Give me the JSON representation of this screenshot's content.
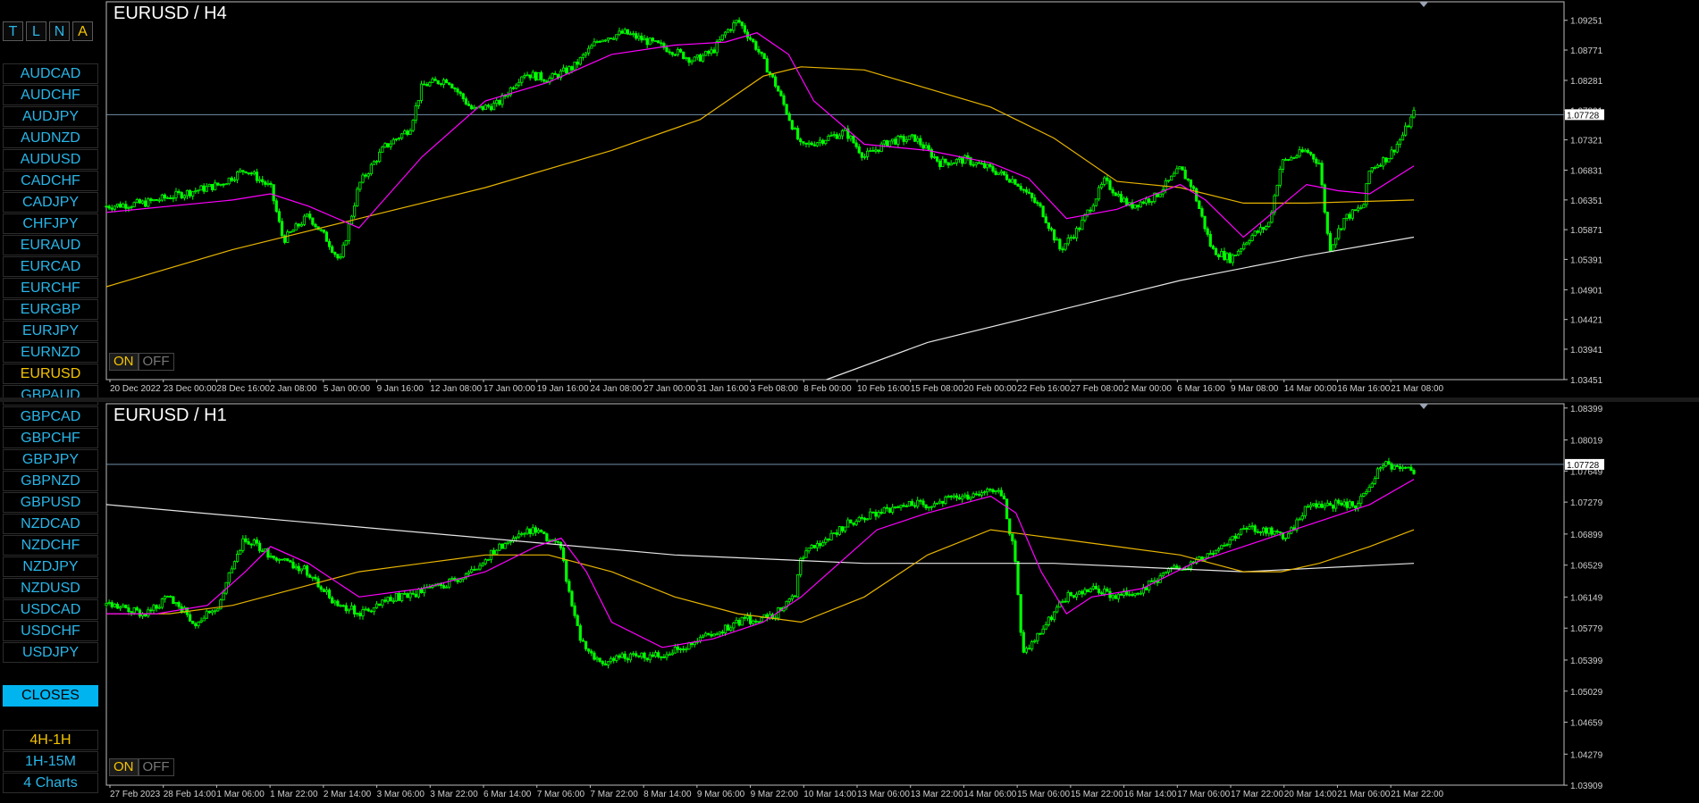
{
  "sidebar": {
    "modes": [
      "T",
      "L",
      "N",
      "A"
    ],
    "selected_mode": "A",
    "symbols": [
      "AUDCAD",
      "AUDCHF",
      "AUDJPY",
      "AUDNZD",
      "AUDUSD",
      "CADCHF",
      "CADJPY",
      "CHFJPY",
      "EURAUD",
      "EURCAD",
      "EURCHF",
      "EURGBP",
      "EURJPY",
      "EURNZD",
      "EURUSD",
      "GBPAUD",
      "GBPCAD",
      "GBPCHF",
      "GBPJPY",
      "GBPNZD",
      "GBPUSD",
      "NZDCAD",
      "NZDCHF",
      "NZDJPY",
      "NZDUSD",
      "USDCAD",
      "USDCHF",
      "USDJPY"
    ],
    "active_symbol": "EURUSD",
    "closes_label": "CLOSES",
    "layouts": [
      "4H-1H",
      "1H-15M",
      "4 Charts"
    ],
    "selected_layout": "4H-1H"
  },
  "colors": {
    "background": "#000000",
    "bull_candle": "#00ff00",
    "ma_fast": "#ff00ff",
    "ma_mid": "#e8b400",
    "ma_slow": "#e6e6e6",
    "current_price_line": "#6f8fa8",
    "sidebar_text": "#29b6e8",
    "selected_text": "#f5c400",
    "closes_bg": "#00b4f0"
  },
  "chart_data": [
    {
      "type": "candlestick",
      "title": "EURUSD / H4",
      "symbol": "EURUSD",
      "timeframe": "H4",
      "current_price": "1.07728",
      "ylim": [
        1.0345,
        1.0955
      ],
      "y_ticks": [
        "1.09251",
        "1.08771",
        "1.08281",
        "1.07801",
        "1.07321",
        "1.06831",
        "1.06351",
        "1.05871",
        "1.05391",
        "1.04901",
        "1.04421",
        "1.03941",
        "1.03451"
      ],
      "x_ticks": [
        "20 Dec 2022",
        "23 Dec 00:00",
        "28 Dec 16:00",
        "2 Jan 08:00",
        "5 Jan 00:00",
        "9 Jan 16:00",
        "12 Jan 08:00",
        "17 Jan 00:00",
        "19 Jan 16:00",
        "24 Jan 08:00",
        "27 Jan 00:00",
        "31 Jan 16:00",
        "3 Feb 08:00",
        "8 Feb 00:00",
        "10 Feb 16:00",
        "15 Feb 08:00",
        "20 Feb 00:00",
        "22 Feb 16:00",
        "27 Feb 08:00",
        "2 Mar 00:00",
        "6 Mar 16:00",
        "9 Mar 08:00",
        "14 Mar 00:00",
        "16 Mar 16:00",
        "21 Mar 08:00"
      ],
      "close_path": [
        [
          0,
          1.0625
        ],
        [
          0.03,
          1.063
        ],
        [
          0.06,
          1.0645
        ],
        [
          0.09,
          1.066
        ],
        [
          0.11,
          1.0685
        ],
        [
          0.13,
          1.0655
        ],
        [
          0.14,
          1.057
        ],
        [
          0.16,
          1.061
        ],
        [
          0.175,
          1.057
        ],
        [
          0.185,
          1.0535
        ],
        [
          0.2,
          1.066
        ],
        [
          0.22,
          1.072
        ],
        [
          0.24,
          1.075
        ],
        [
          0.25,
          1.082
        ],
        [
          0.27,
          1.083
        ],
        [
          0.29,
          1.078
        ],
        [
          0.31,
          1.079
        ],
        [
          0.33,
          1.084
        ],
        [
          0.35,
          1.083
        ],
        [
          0.37,
          1.085
        ],
        [
          0.39,
          1.0895
        ],
        [
          0.41,
          1.0905
        ],
        [
          0.43,
          1.089
        ],
        [
          0.45,
          1.0875
        ],
        [
          0.465,
          1.086
        ],
        [
          0.48,
          1.0875
        ],
        [
          0.49,
          1.0905
        ],
        [
          0.5,
          1.0925
        ],
        [
          0.515,
          1.088
        ],
        [
          0.53,
          1.082
        ],
        [
          0.55,
          1.072
        ],
        [
          0.57,
          1.0735
        ],
        [
          0.585,
          1.0745
        ],
        [
          0.6,
          1.0705
        ],
        [
          0.62,
          1.073
        ],
        [
          0.64,
          1.0735
        ],
        [
          0.66,
          1.0695
        ],
        [
          0.68,
          1.07
        ],
        [
          0.7,
          1.0685
        ],
        [
          0.72,
          1.0665
        ],
        [
          0.74,
          1.062
        ],
        [
          0.755,
          1.0555
        ],
        [
          0.77,
          1.059
        ],
        [
          0.79,
          1.0665
        ],
        [
          0.81,
          1.0625
        ],
        [
          0.83,
          1.064
        ],
        [
          0.85,
          1.0685
        ],
        [
          0.86,
          1.0655
        ],
        [
          0.875,
          1.0555
        ],
        [
          0.89,
          1.054
        ],
        [
          0.905,
          1.0575
        ],
        [
          0.92,
          1.0595
        ],
        [
          0.93,
          1.0695
        ],
        [
          0.95,
          1.0715
        ],
        [
          0.96,
          1.0695
        ],
        [
          0.968,
          1.0555
        ],
        [
          0.98,
          1.0605
        ],
        [
          0.995,
          1.0625
        ],
        [
          1.0,
          1.0685
        ],
        [
          1.015,
          1.0705
        ],
        [
          1.025,
          1.0735
        ],
        [
          1.035,
          1.0775
        ]
      ],
      "ma_fast": [
        [
          0,
          1.0615
        ],
        [
          0.1,
          1.0635
        ],
        [
          0.13,
          1.0645
        ],
        [
          0.16,
          1.0625
        ],
        [
          0.2,
          1.059
        ],
        [
          0.25,
          1.0705
        ],
        [
          0.3,
          1.0795
        ],
        [
          0.35,
          1.0825
        ],
        [
          0.4,
          1.087
        ],
        [
          0.45,
          1.0885
        ],
        [
          0.49,
          1.089
        ],
        [
          0.515,
          1.0905
        ],
        [
          0.54,
          1.087
        ],
        [
          0.56,
          1.0795
        ],
        [
          0.6,
          1.0725
        ],
        [
          0.65,
          1.0715
        ],
        [
          0.7,
          1.0695
        ],
        [
          0.73,
          1.067
        ],
        [
          0.76,
          1.0605
        ],
        [
          0.8,
          1.062
        ],
        [
          0.85,
          1.066
        ],
        [
          0.87,
          1.0635
        ],
        [
          0.9,
          1.0575
        ],
        [
          0.95,
          1.066
        ],
        [
          0.975,
          1.065
        ],
        [
          1.0,
          1.0645
        ],
        [
          1.035,
          1.069
        ]
      ],
      "ma_mid": [
        [
          0,
          1.0495
        ],
        [
          0.1,
          1.0555
        ],
        [
          0.2,
          1.0605
        ],
        [
          0.3,
          1.0655
        ],
        [
          0.4,
          1.0715
        ],
        [
          0.47,
          1.0765
        ],
        [
          0.52,
          1.0835
        ],
        [
          0.55,
          1.085
        ],
        [
          0.6,
          1.0845
        ],
        [
          0.65,
          1.0815
        ],
        [
          0.7,
          1.0785
        ],
        [
          0.75,
          1.0735
        ],
        [
          0.8,
          1.0665
        ],
        [
          0.85,
          1.0655
        ],
        [
          0.9,
          1.063
        ],
        [
          0.95,
          1.063
        ],
        [
          1.035,
          1.0635
        ]
      ],
      "ma_slow": [
        [
          0.57,
          1.0345
        ],
        [
          0.65,
          1.0405
        ],
        [
          0.75,
          1.0455
        ],
        [
          0.85,
          1.0505
        ],
        [
          0.95,
          1.0545
        ],
        [
          1.035,
          1.0575
        ]
      ]
    },
    {
      "type": "candlestick",
      "title": "EURUSD / H1",
      "symbol": "EURUSD",
      "timeframe": "H1",
      "current_price": "1.07728",
      "ylim": [
        1.0391,
        1.0845
      ],
      "y_ticks": [
        "1.08399",
        "1.08019",
        "1.07649",
        "1.07279",
        "1.06899",
        "1.06529",
        "1.06149",
        "1.05779",
        "1.05399",
        "1.05029",
        "1.04659",
        "1.04279",
        "1.03909"
      ],
      "x_ticks": [
        "27 Feb 2023",
        "28 Feb 14:00",
        "1 Mar 06:00",
        "1 Mar 22:00",
        "2 Mar 14:00",
        "3 Mar 06:00",
        "3 Mar 22:00",
        "6 Mar 14:00",
        "7 Mar 06:00",
        "7 Mar 22:00",
        "8 Mar 14:00",
        "9 Mar 06:00",
        "9 Mar 22:00",
        "10 Mar 14:00",
        "13 Mar 06:00",
        "13 Mar 22:00",
        "14 Mar 06:00",
        "15 Mar 06:00",
        "15 Mar 22:00",
        "16 Mar 14:00",
        "17 Mar 06:00",
        "17 Mar 22:00",
        "20 Mar 14:00",
        "21 Mar 06:00",
        "21 Mar 22:00"
      ],
      "close_path": [
        [
          0,
          1.0605
        ],
        [
          0.03,
          1.0595
        ],
        [
          0.05,
          1.0615
        ],
        [
          0.07,
          1.0585
        ],
        [
          0.09,
          1.0605
        ],
        [
          0.1,
          1.0655
        ],
        [
          0.11,
          1.0685
        ],
        [
          0.13,
          1.0665
        ],
        [
          0.16,
          1.0645
        ],
        [
          0.18,
          1.061
        ],
        [
          0.2,
          1.0595
        ],
        [
          0.23,
          1.0615
        ],
        [
          0.26,
          1.0625
        ],
        [
          0.29,
          1.0645
        ],
        [
          0.3,
          1.066
        ],
        [
          0.32,
          1.0685
        ],
        [
          0.34,
          1.0695
        ],
        [
          0.36,
          1.0675
        ],
        [
          0.365,
          1.0625
        ],
        [
          0.375,
          1.0565
        ],
        [
          0.39,
          1.0535
        ],
        [
          0.41,
          1.0545
        ],
        [
          0.44,
          1.0545
        ],
        [
          0.47,
          1.0565
        ],
        [
          0.5,
          1.0585
        ],
        [
          0.53,
          1.0595
        ],
        [
          0.545,
          1.0615
        ],
        [
          0.55,
          1.0665
        ],
        [
          0.57,
          1.0685
        ],
        [
          0.59,
          1.0705
        ],
        [
          0.61,
          1.0715
        ],
        [
          0.63,
          1.0725
        ],
        [
          0.65,
          1.0725
        ],
        [
          0.68,
          1.0735
        ],
        [
          0.7,
          1.0745
        ],
        [
          0.71,
          1.0735
        ],
        [
          0.72,
          1.0655
        ],
        [
          0.725,
          1.0545
        ],
        [
          0.74,
          1.0575
        ],
        [
          0.76,
          1.0615
        ],
        [
          0.78,
          1.0625
        ],
        [
          0.8,
          1.0615
        ],
        [
          0.82,
          1.0625
        ],
        [
          0.84,
          1.0645
        ],
        [
          0.86,
          1.0655
        ],
        [
          0.88,
          1.0675
        ],
        [
          0.9,
          1.0695
        ],
        [
          0.92,
          1.0695
        ],
        [
          0.935,
          1.0685
        ],
        [
          0.95,
          1.0725
        ],
        [
          0.97,
          1.0725
        ],
        [
          0.99,
          1.0725
        ],
        [
          1.0,
          1.0745
        ],
        [
          1.01,
          1.0775
        ],
        [
          1.025,
          1.0765
        ],
        [
          1.035,
          1.0765
        ]
      ],
      "ma_fast": [
        [
          0,
          1.0595
        ],
        [
          0.04,
          1.0595
        ],
        [
          0.08,
          1.0605
        ],
        [
          0.11,
          1.0645
        ],
        [
          0.13,
          1.0675
        ],
        [
          0.16,
          1.0655
        ],
        [
          0.2,
          1.0615
        ],
        [
          0.25,
          1.0625
        ],
        [
          0.3,
          1.0645
        ],
        [
          0.34,
          1.0675
        ],
        [
          0.36,
          1.0685
        ],
        [
          0.38,
          1.0645
        ],
        [
          0.4,
          1.0585
        ],
        [
          0.44,
          1.0555
        ],
        [
          0.48,
          1.0565
        ],
        [
          0.52,
          1.0585
        ],
        [
          0.55,
          1.0615
        ],
        [
          0.58,
          1.0655
        ],
        [
          0.61,
          1.0695
        ],
        [
          0.65,
          1.0715
        ],
        [
          0.7,
          1.0735
        ],
        [
          0.72,
          1.0715
        ],
        [
          0.74,
          1.0645
        ],
        [
          0.76,
          1.0595
        ],
        [
          0.78,
          1.0615
        ],
        [
          0.82,
          1.0625
        ],
        [
          0.86,
          1.0655
        ],
        [
          0.9,
          1.0675
        ],
        [
          0.94,
          1.0695
        ],
        [
          0.98,
          1.0715
        ],
        [
          1.0,
          1.0725
        ],
        [
          1.035,
          1.0755
        ]
      ],
      "ma_mid": [
        [
          0,
          1.0595
        ],
        [
          0.05,
          1.0595
        ],
        [
          0.1,
          1.0605
        ],
        [
          0.15,
          1.0625
        ],
        [
          0.2,
          1.0645
        ],
        [
          0.25,
          1.0655
        ],
        [
          0.3,
          1.0665
        ],
        [
          0.35,
          1.0665
        ],
        [
          0.4,
          1.0645
        ],
        [
          0.45,
          1.0615
        ],
        [
          0.5,
          1.0595
        ],
        [
          0.55,
          1.0585
        ],
        [
          0.6,
          1.0615
        ],
        [
          0.65,
          1.0665
        ],
        [
          0.7,
          1.0695
        ],
        [
          0.75,
          1.0685
        ],
        [
          0.8,
          1.0675
        ],
        [
          0.85,
          1.0665
        ],
        [
          0.9,
          1.0645
        ],
        [
          0.93,
          1.0645
        ],
        [
          0.96,
          1.0655
        ],
        [
          1.0,
          1.0675
        ],
        [
          1.035,
          1.0695
        ]
      ],
      "ma_slow": [
        [
          0,
          1.0725
        ],
        [
          0.15,
          1.0705
        ],
        [
          0.3,
          1.0685
        ],
        [
          0.45,
          1.0665
        ],
        [
          0.6,
          1.0655
        ],
        [
          0.75,
          1.0655
        ],
        [
          0.9,
          1.0645
        ],
        [
          1.035,
          1.0655
        ]
      ]
    }
  ],
  "buttons": {
    "on_label": "ON",
    "off_label": "OFF"
  }
}
